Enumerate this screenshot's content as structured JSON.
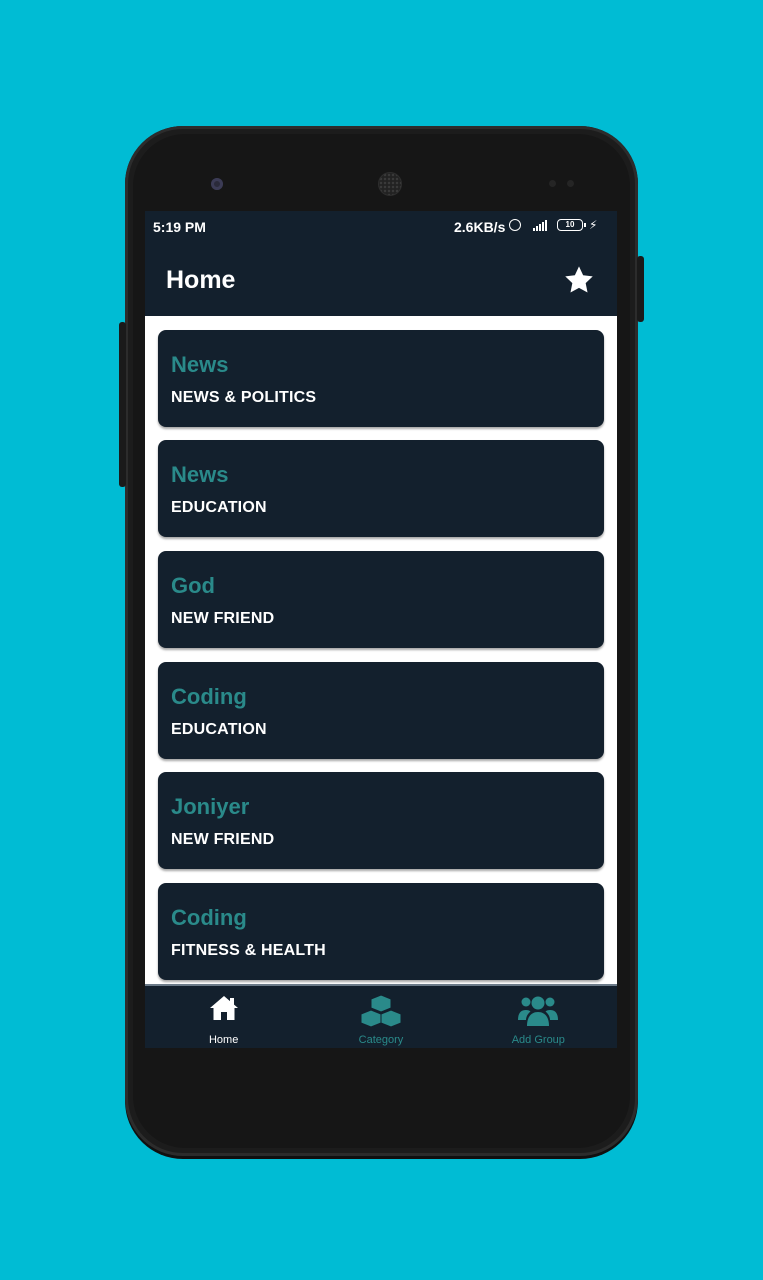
{
  "status_bar": {
    "time": "5:19 PM",
    "speed": "2.6KB/s",
    "battery": "10"
  },
  "app_bar": {
    "title": "Home",
    "favorite_icon": "star-icon"
  },
  "groups": [
    {
      "title": "News",
      "category": "NEWS & POLITICS"
    },
    {
      "title": "News",
      "category": "EDUCATION"
    },
    {
      "title": "God",
      "category": "NEW FRIEND"
    },
    {
      "title": "Coding",
      "category": "EDUCATION"
    },
    {
      "title": "Joniyer",
      "category": "NEW FRIEND"
    },
    {
      "title": "Coding",
      "category": "FITNESS & HEALTH"
    }
  ],
  "bottom_nav": {
    "items": [
      {
        "label": "Home",
        "icon": "home-icon",
        "active": true
      },
      {
        "label": "Category",
        "icon": "cubes-icon",
        "active": false
      },
      {
        "label": "Add Group",
        "icon": "users-icon",
        "active": false
      }
    ]
  },
  "colors": {
    "background": "#00bcd4",
    "app_bar": "#13202d",
    "card": "#13202d",
    "accent_teal": "#2a8a8a",
    "text_white": "#ffffff"
  }
}
